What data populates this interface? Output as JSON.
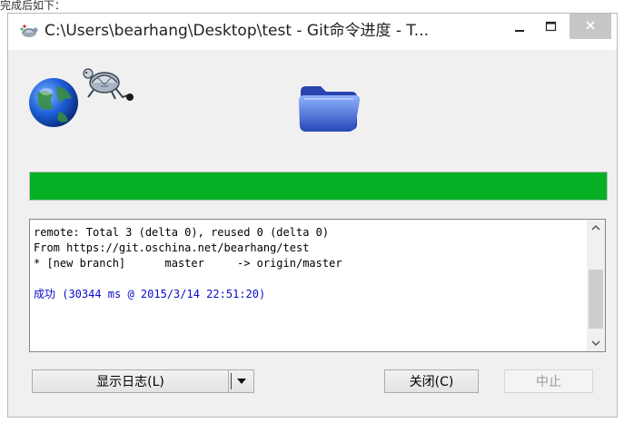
{
  "caption": "完成后如下：",
  "window": {
    "title": "C:\\Users\\bearhang\\Desktop\\test - Git命令进度 - T..."
  },
  "progress": {
    "percent": 100,
    "color": "#06b025"
  },
  "log": {
    "lines": [
      "remote: Total 3 (delta 0), reused 0 (delta 0)",
      "From https://git.oschina.net/bearhang/test",
      "* [new branch]      master     -> origin/master",
      "",
      "成功 (30344 ms @ 2015/3/14 22:51:20)"
    ]
  },
  "buttons": {
    "show_log": "显示日志(L)",
    "close": "关闭(C)",
    "abort": "中止"
  },
  "icons": {
    "app": "tortoise-git-icon",
    "globe": "globe-icon",
    "tortoise": "tortoise-icon",
    "folder": "folder-icon"
  }
}
